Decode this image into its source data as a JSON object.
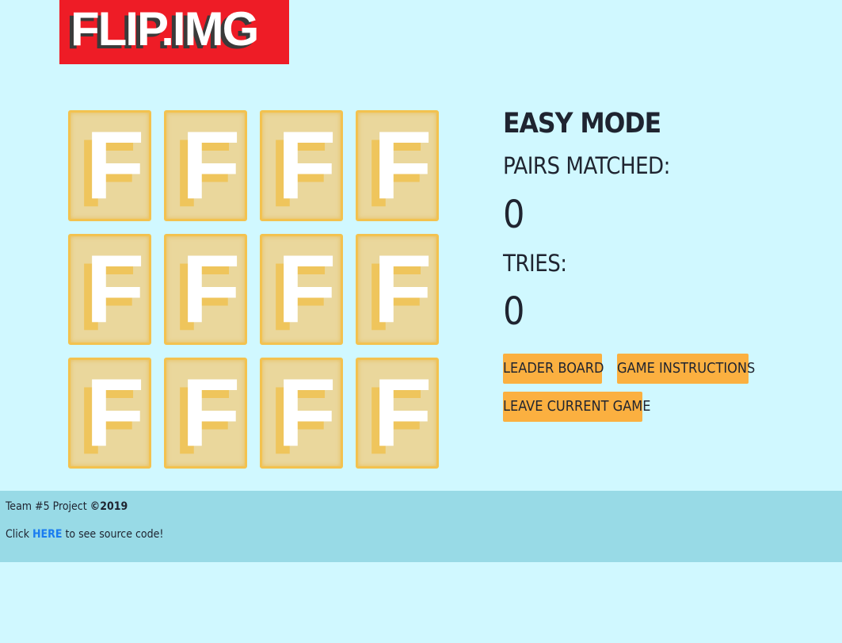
{
  "logo": {
    "text": "FLIP.IMG",
    "color": "#ee1c26"
  },
  "board": {
    "card_back_letter": "F",
    "card_color": "#ead79c",
    "card_border_color": "#f3c24f",
    "rows": 3,
    "columns": 4,
    "cards": [
      {
        "state": "face-down"
      },
      {
        "state": "face-down"
      },
      {
        "state": "face-down"
      },
      {
        "state": "face-down"
      },
      {
        "state": "face-down"
      },
      {
        "state": "face-down"
      },
      {
        "state": "face-down"
      },
      {
        "state": "face-down"
      },
      {
        "state": "face-down"
      },
      {
        "state": "face-down"
      },
      {
        "state": "face-down"
      },
      {
        "state": "face-down"
      }
    ]
  },
  "panel": {
    "mode_title": "EASY MODE",
    "pairs_label": "PAIRS MATCHED:",
    "pairs_value": "0",
    "tries_label": "TRIES:",
    "tries_value": "0",
    "leaderboard_label": "LEADER BOARD",
    "instructions_label": "GAME INSTRUCTIONS",
    "leave_label": "LEAVE CURRENT GAME",
    "button_color": "#fbb040"
  },
  "footer": {
    "team_text": "Team #5 Project ",
    "copyright": "©2019",
    "click_text": "Click ",
    "link_text": "HERE",
    "after_link_text": " to see source code!",
    "background": "#98dae6",
    "link_color": "#1a7cf0"
  },
  "colors": {
    "page_background": "#d0f8ff"
  }
}
